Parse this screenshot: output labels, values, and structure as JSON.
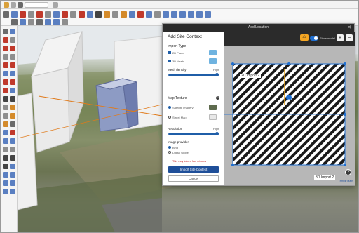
{
  "dialog": {
    "title": "Add Location",
    "close_glyph": "✕",
    "heading": "Add Site Context",
    "import_type": {
      "label": "Import Type",
      "options": [
        {
          "label": "2D Plane",
          "checked": true
        },
        {
          "label": "3D Mesh",
          "checked": true
        }
      ]
    },
    "mesh_density": {
      "label": "Mesh density",
      "high": "High",
      "level": 1.0
    },
    "map_texture": {
      "label": "Map Texture",
      "options": [
        {
          "label": "Satellite imagery",
          "selected": true
        },
        {
          "label": "Street Map",
          "selected": false
        }
      ]
    },
    "resolution": {
      "label": "Resolution",
      "high": "High",
      "level": 1.0
    },
    "image_provider": {
      "label": "Image provider",
      "options": [
        {
          "label": "Bing",
          "selected": true
        },
        {
          "label": "Digital Globe",
          "selected": false
        }
      ]
    },
    "warning": "This may take a few minutes",
    "import_button": "Import Site Context",
    "cancel_button": "Cancel",
    "help_glyph": "?"
  },
  "map": {
    "show_label": "Show model",
    "show_model_on": true,
    "zoom_in": "+",
    "zoom_out": "−",
    "warning_glyph": "⚠",
    "label_2d": "2D Import 2",
    "label_3d": "3D Import 2",
    "attribution": "Trimble Maps",
    "help_glyph": "?"
  },
  "icons": {
    "expand": "expand-icon",
    "accent": "#1f4f99"
  }
}
